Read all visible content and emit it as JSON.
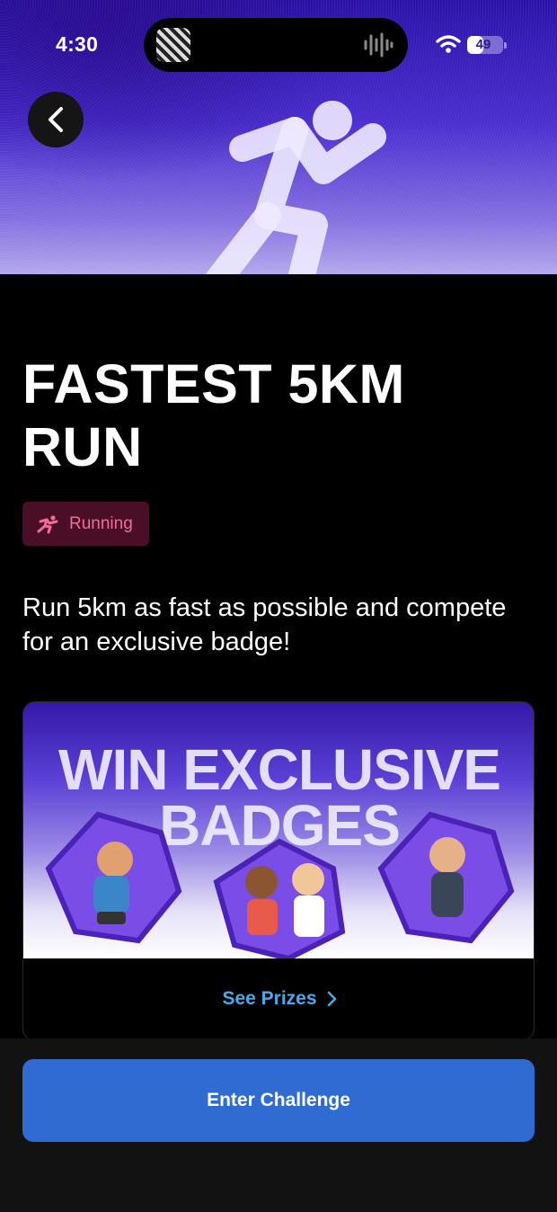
{
  "status_bar": {
    "time": "4:30",
    "battery_level": "49",
    "battery_fraction": 0.49
  },
  "header": {
    "back_icon": "chevron-left-icon",
    "hero_icon": "running-person-icon"
  },
  "challenge": {
    "title": "FASTEST 5KM RUN",
    "tag": {
      "label": "Running",
      "icon": "running-person-icon",
      "color": "#ef6d96"
    },
    "description": "Run 5km as fast as possible and compete for an exclusive badge!"
  },
  "prizes": {
    "banner_headline_line1": "WIN EXCLUSIVE",
    "banner_headline_line2": "BADGES",
    "see_prizes_label": "See Prizes",
    "link_color": "#4aa8e8"
  },
  "footer": {
    "enter_label": "Enter Challenge",
    "button_color": "#2f6bd1"
  }
}
